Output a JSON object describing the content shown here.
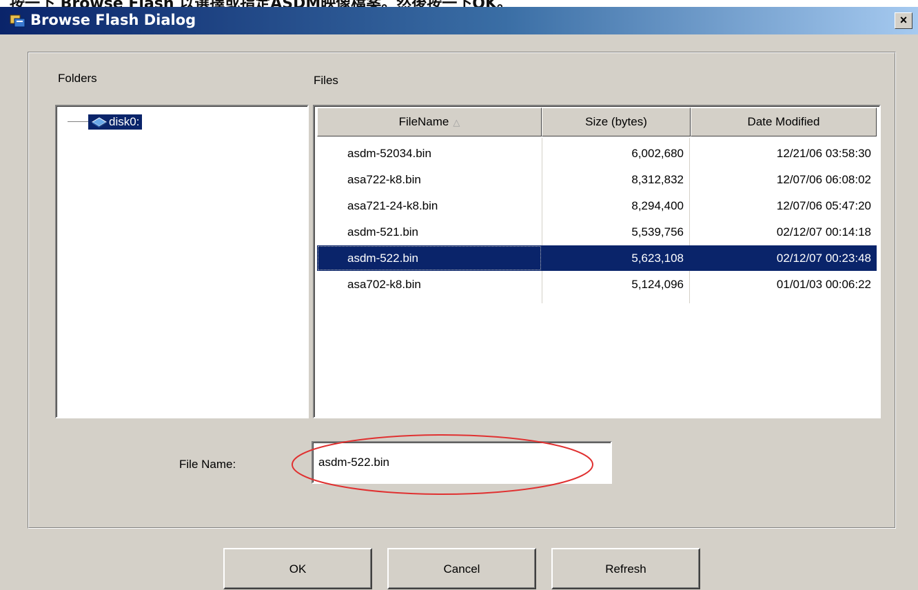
{
  "caption": {
    "text": "按一下 Browse Flash 以選擇或指定ASDM映像檔案。然後按一下OK。"
  },
  "window": {
    "title": "Browse Flash Dialog",
    "close_glyph": "×",
    "title_icon": "browse-flash-icon"
  },
  "folders": {
    "label": "Folders",
    "tree": [
      {
        "label": "disk0:",
        "icon": "disk-icon",
        "selected": true
      }
    ]
  },
  "files": {
    "label": "Files",
    "columns": [
      {
        "label": "FileName",
        "sort_glyph": "△"
      },
      {
        "label": "Size (bytes)"
      },
      {
        "label": "Date Modified"
      }
    ],
    "rows": [
      {
        "name": "asdm-52034.bin",
        "size": "6,002,680",
        "date": "12/21/06 03:58:30",
        "selected": false
      },
      {
        "name": "asa722-k8.bin",
        "size": "8,312,832",
        "date": "12/07/06 06:08:02",
        "selected": false
      },
      {
        "name": "asa721-24-k8.bin",
        "size": "8,294,400",
        "date": "12/07/06 05:47:20",
        "selected": false
      },
      {
        "name": "asdm-521.bin",
        "size": "5,539,756",
        "date": "02/12/07 00:14:18",
        "selected": false
      },
      {
        "name": "asdm-522.bin",
        "size": "5,623,108",
        "date": "02/12/07 00:23:48",
        "selected": true
      },
      {
        "name": "asa702-k8.bin",
        "size": "5,124,096",
        "date": "01/01/03 00:06:22",
        "selected": false
      }
    ]
  },
  "file_name": {
    "label": "File Name:",
    "value": "asdm-522.bin",
    "highlight_color": "#e03030"
  },
  "buttons": {
    "ok": "OK",
    "cancel": "Cancel",
    "refresh": "Refresh"
  },
  "colors": {
    "selection": "#0a246a",
    "face": "#d4d0c8"
  }
}
